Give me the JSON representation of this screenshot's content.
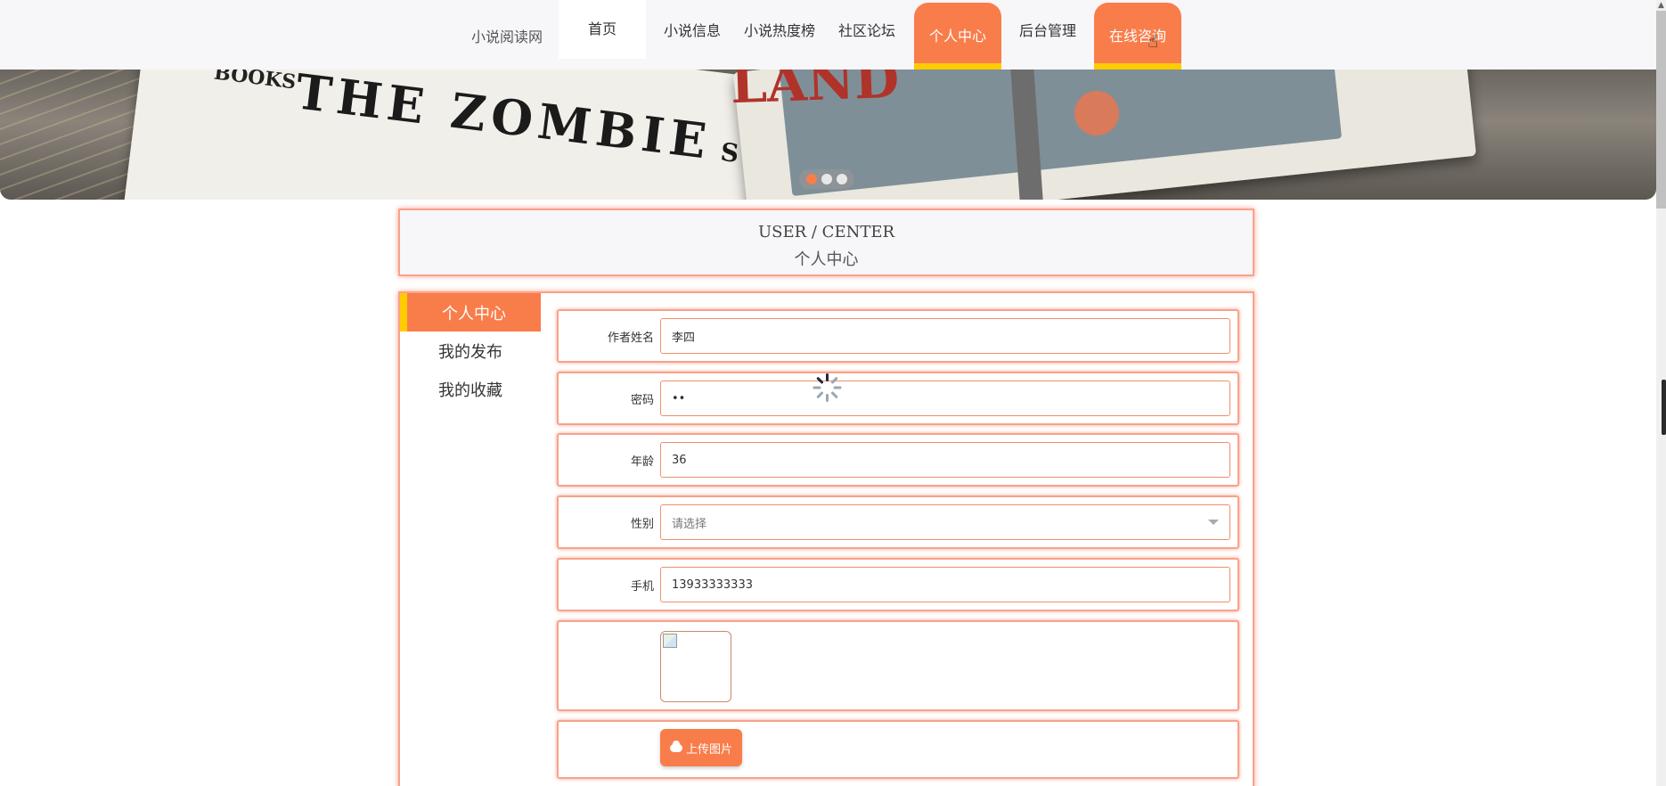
{
  "nav": {
    "site_name": "小说阅读网",
    "items": [
      {
        "label": "首页"
      },
      {
        "label": "小说信息"
      },
      {
        "label": "小说热度榜"
      },
      {
        "label": "社区论坛"
      },
      {
        "label": "个人中心"
      },
      {
        "label": "后台管理"
      },
      {
        "label": "在线咨询"
      }
    ]
  },
  "banner": {
    "book_title": "THE ZOMBIE",
    "book_subtitle": "SURVIV",
    "spine_text": "BOOKS",
    "red_text": "LAND",
    "slides": 3,
    "active_slide": 1
  },
  "header": {
    "en": "USER / CENTER",
    "cn": "个人中心"
  },
  "sidebar": {
    "items": [
      {
        "label": "个人中心"
      },
      {
        "label": "我的发布"
      },
      {
        "label": "我的收藏"
      }
    ]
  },
  "form": {
    "name_label": "作者姓名",
    "name_value": "李四",
    "password_label": "密码",
    "password_value": "••",
    "age_label": "年龄",
    "age_value": "36",
    "gender_label": "性别",
    "gender_placeholder": "请选择",
    "phone_label": "手机",
    "phone_value": "13933333333",
    "upload_label": "上传图片"
  },
  "icons": {
    "dropdown": "chevron-down-icon",
    "upload": "cloud-upload-icon",
    "loading": "spinner-icon",
    "cursor": "hand-pointer-icon",
    "broken_image": "broken-image-icon"
  },
  "colors": {
    "accent": "#f97d4b",
    "highlight": "#ffcc00",
    "border": "#f7a38b"
  }
}
